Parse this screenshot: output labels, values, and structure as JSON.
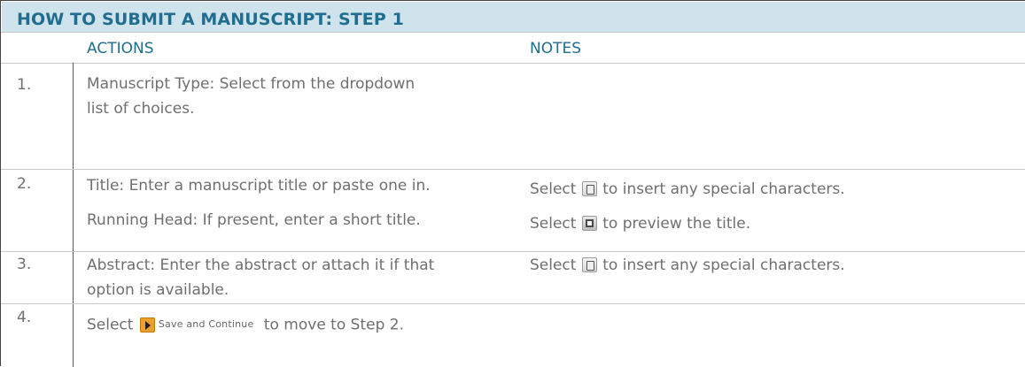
{
  "title": "HOW TO SUBMIT A MANUSCRIPT:  STEP 1",
  "headers": {
    "actions": "ACTIONS",
    "notes": "NOTES"
  },
  "rows": [
    {
      "number": "1.",
      "action": [
        "Manuscript Type: Select from the dropdown",
        "list of choices."
      ]
    },
    {
      "number": "2.",
      "action": [
        "Title: Enter a manuscript title or paste one in.",
        "Running Head: If present, enter a short title."
      ],
      "notes": [
        {
          "before": "Select",
          "icon": "special-characters-icon",
          "after": "to insert any special characters."
        },
        {
          "before": "Select",
          "icon": "preview-icon",
          "after": "to preview the title."
        }
      ]
    },
    {
      "number": "3.",
      "action": [
        "Abstract: Enter the abstract or attach it if that",
        "option is available."
      ],
      "notes": [
        {
          "before": "Select",
          "icon": "special-characters-icon",
          "after": "to insert any special characters."
        }
      ]
    },
    {
      "number": "4.",
      "action_before": "Select",
      "button_label": "Save and Continue",
      "action_after": "to move to Step 2."
    }
  ],
  "colors": {
    "accent": "#1f6d8f",
    "title_bar": "#cfe3ec",
    "text": "#6f6f6f",
    "save_button": "#e9a12a"
  }
}
